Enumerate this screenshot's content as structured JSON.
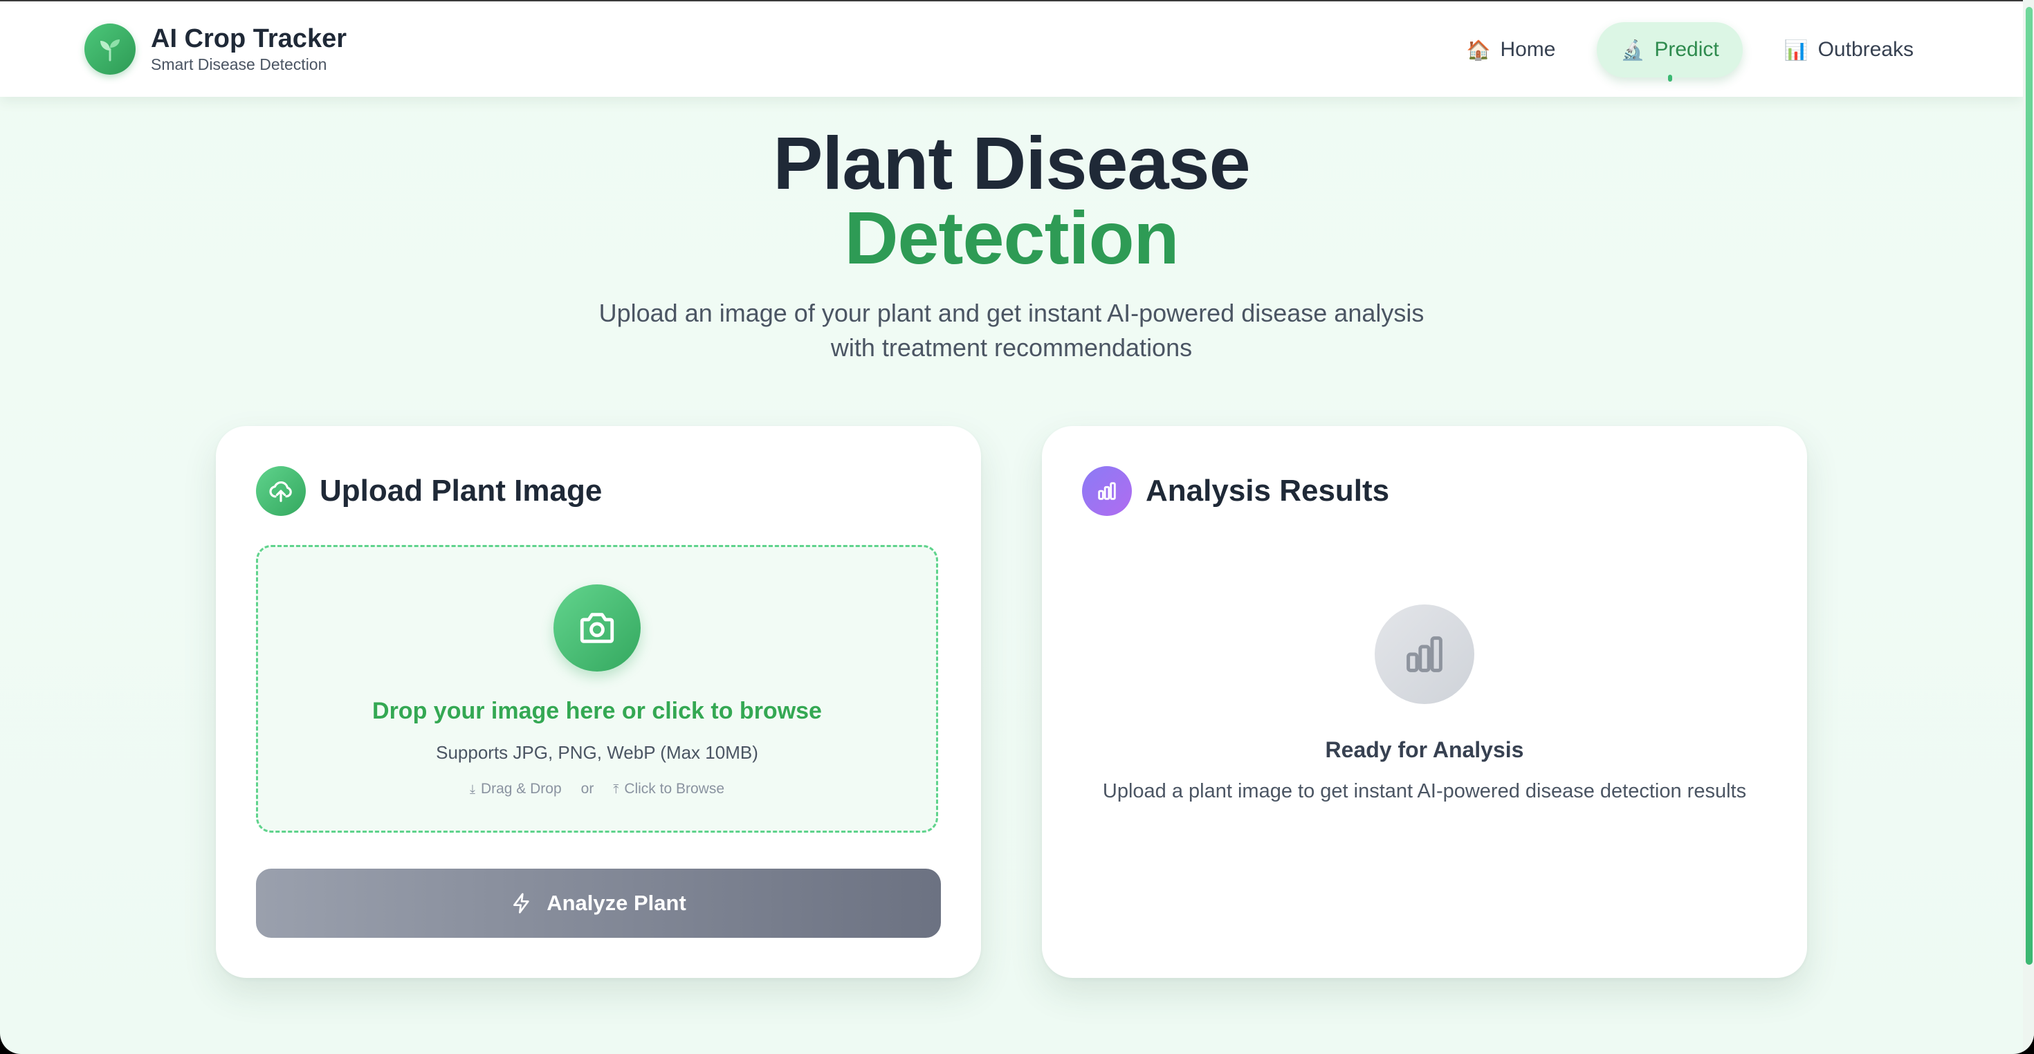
{
  "app": {
    "title": "AI Crop Tracker",
    "subtitle": "Smart Disease Detection",
    "logo_icon": "seedling-icon"
  },
  "nav": {
    "items": [
      {
        "label": "Home",
        "icon": "house-icon",
        "emoji": "🏠",
        "active": false
      },
      {
        "label": "Predict",
        "icon": "microscope-icon",
        "emoji": "🔬",
        "active": true
      },
      {
        "label": "Outbreaks",
        "icon": "bar-chart-icon",
        "emoji": "📊",
        "active": false
      }
    ]
  },
  "hero": {
    "title_line1": "Plant Disease",
    "title_line2": "Detection",
    "subtitle_line1": "Upload an image of your plant and get instant AI-powered disease analysis",
    "subtitle_line2": "with treatment recommendations"
  },
  "upload": {
    "title": "Upload Plant Image",
    "icon": "cloud-upload-icon",
    "drop_title": "Drop your image here or click to browse",
    "drop_sub": "Supports JPG, PNG, WebP (Max 10MB)",
    "hint_drag": "Drag & Drop",
    "hint_or": "or",
    "hint_browse": "Click to Browse",
    "button_label": "Analyze Plant"
  },
  "results": {
    "title": "Analysis Results",
    "icon": "bar-chart-icon",
    "empty_title": "Ready for Analysis",
    "empty_sub": "Upload a plant image to get instant AI-powered disease detection results"
  },
  "colors": {
    "brand_green": "#2e9b55",
    "accent_green": "#34a853",
    "active_nav_bg": "#dcf6e5",
    "results_icon_purple": "#8b7bf5",
    "button_gray": "#6c7282",
    "heading_dark": "#1f2937"
  }
}
